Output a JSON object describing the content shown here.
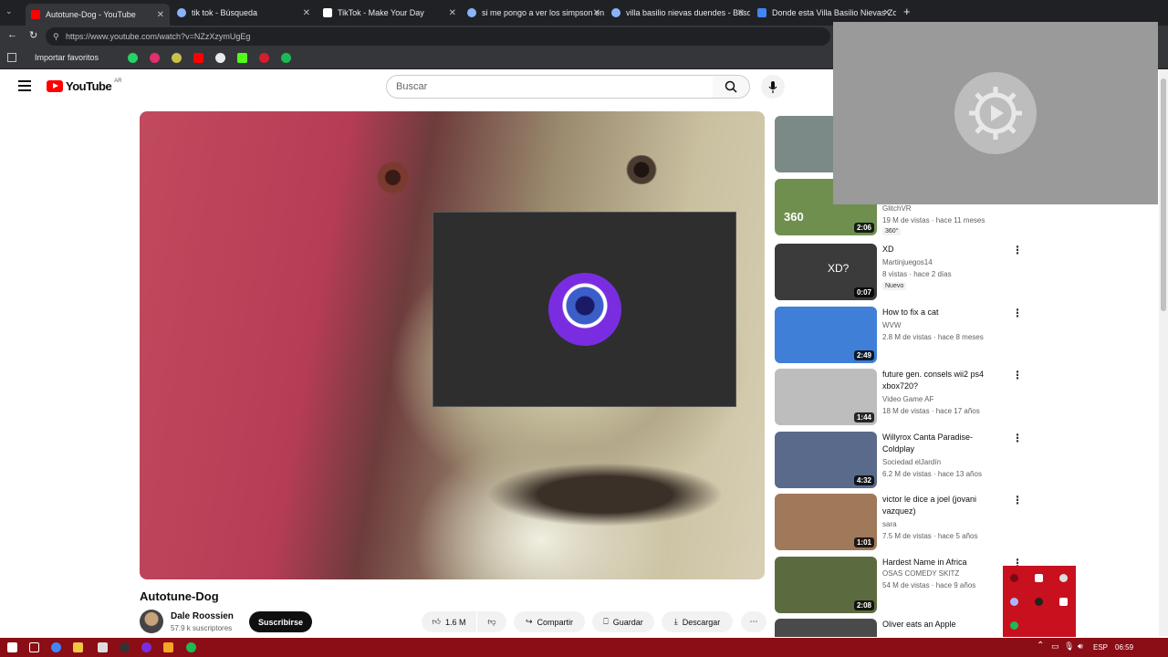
{
  "browser": {
    "tabs": [
      {
        "label": "Autotune-Dog - YouTube",
        "active": true,
        "icon_color": "#ff0000"
      },
      {
        "label": "tik tok - Búsqueda",
        "active": false,
        "icon_color": "#8ab4f8"
      },
      {
        "label": "TikTok - Make Your Day",
        "active": false,
        "icon_color": "#ffffff"
      },
      {
        "label": "si me pongo a ver los simpson en",
        "active": false,
        "icon_color": "#8ab4f8"
      },
      {
        "label": "villa basilio nievas duendes - Búsq",
        "active": false,
        "icon_color": "#8ab4f8"
      },
      {
        "label": "Donde esta Villa Basilio Nievas Zo",
        "active": false,
        "icon_color": "#4285f4"
      }
    ],
    "url": "https://www.youtube.com/watch?v=NZzXzymUgEg",
    "bookmarks_label": "Importar favoritos"
  },
  "youtube": {
    "logo_text": "YouTube",
    "region": "AR",
    "search_placeholder": "Buscar"
  },
  "video": {
    "title": "Autotune-Dog",
    "channel": "Dale Roossien",
    "subscribers": "57.9 k suscriptores",
    "subscribe_label": "Suscribirse",
    "likes": "1.6 M",
    "share_label": "Compartir",
    "save_label": "Guardar",
    "download_label": "Descargar"
  },
  "recommendations": [
    {
      "title": "",
      "channel": "",
      "meta": "",
      "duration": "",
      "badge": "",
      "thumb_color": "#7b8a86"
    },
    {
      "title": "",
      "channel": "GlitchVR",
      "meta": "19 M de vistas · hace 11 meses",
      "duration": "2:06",
      "badge": "360°",
      "thumb_color": "#6f8f4f"
    },
    {
      "title": "XD",
      "channel": "Martinjuegos14",
      "meta": "8 vistas · hace 2 días",
      "duration": "0:07",
      "badge": "Nuevo",
      "thumb_color": "#3b3b3b"
    },
    {
      "title": "How to fix a cat",
      "channel": "WVW",
      "meta": "2.8 M de vistas · hace 8 meses",
      "duration": "2:49",
      "badge": "",
      "thumb_color": "#3f7fd8"
    },
    {
      "title": "future gen. consels wii2 ps4 xbox720?",
      "channel": "Video Game AF",
      "meta": "18 M de vistas · hace 17 años",
      "duration": "1:44",
      "badge": "",
      "thumb_color": "#bdbdbd"
    },
    {
      "title": "Willyrox Canta Paradise-Coldplay",
      "channel": "Sociedad elJardín",
      "meta": "6.2 M de vistas · hace 13 años",
      "duration": "4:32",
      "badge": "",
      "thumb_color": "#5a6a8a"
    },
    {
      "title": "victor le dice a joel (jovani vazquez)",
      "channel": "sara",
      "meta": "7.5 M de vistas · hace 5 años",
      "duration": "1:01",
      "badge": "",
      "thumb_color": "#a0785a"
    },
    {
      "title": "Hardest Name in Africa",
      "channel": "OSAS COMEDY SKITZ",
      "meta": "54 M de vistas · hace 9 años",
      "duration": "2:08",
      "badge": "",
      "thumb_color": "#5b6b3f"
    },
    {
      "title": "Oliver eats an Apple",
      "channel": "",
      "meta": "",
      "duration": "",
      "badge": "",
      "thumb_color": "#4a4a4a"
    }
  ],
  "taskbar": {
    "lang": "ESP",
    "time": "06:59"
  }
}
